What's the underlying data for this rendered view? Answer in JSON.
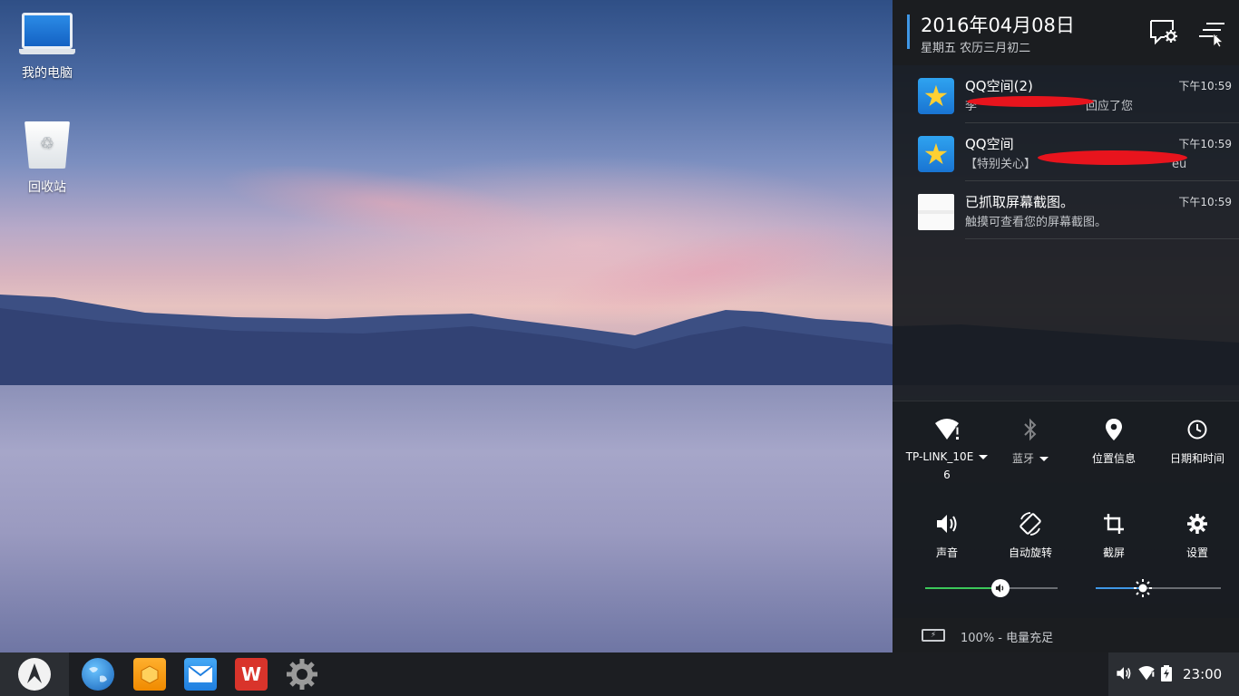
{
  "desktop": {
    "icons": [
      {
        "label": "我的电脑",
        "icon": "computer-icon"
      },
      {
        "label": "回收站",
        "icon": "recycle-bin-icon"
      }
    ]
  },
  "panel": {
    "date": "2016年04月08日",
    "lunar": "星期五 农历三月初二",
    "header_buttons": [
      "notification-settings-icon",
      "clear-all-icon"
    ],
    "notifications": [
      {
        "app": "QQ空间(2)",
        "body_visible_start": "李",
        "body_visible_end": "回应了您",
        "time": "下午10:59",
        "icon": "qzone-star-icon"
      },
      {
        "app": "QQ空间",
        "body_visible_start": "【特别关心】",
        "body_visible_end": "eu",
        "time": "下午10:59",
        "icon": "qzone-star-icon"
      },
      {
        "app": "已抓取屏幕截图。",
        "body": "触摸可查看您的屏幕截图。",
        "time": "下午10:59",
        "icon": "screenshot-thumbnail"
      }
    ],
    "quick_settings": {
      "wifi": {
        "label": "TP-LINK_10E",
        "label_line2": "6",
        "icon": "wifi-alert-icon"
      },
      "bluetooth": {
        "label": "蓝牙",
        "icon": "bluetooth-icon"
      },
      "location": {
        "label": "位置信息",
        "icon": "location-pin-icon"
      },
      "datetime": {
        "label": "日期和时间",
        "icon": "clock-icon"
      },
      "sound": {
        "label": "声音",
        "icon": "speaker-icon"
      },
      "rotate": {
        "label": "自动旋转",
        "icon": "rotate-icon"
      },
      "screenshot": {
        "label": "截屏",
        "icon": "crop-icon"
      },
      "settings": {
        "label": "设置",
        "icon": "gear-icon"
      }
    },
    "sliders": {
      "volume": {
        "fraction": 0.57,
        "color": "#3cc85a",
        "icon": "speaker-icon"
      },
      "brightness": {
        "fraction": 0.38,
        "color": "#3f97e6",
        "icon": "sun-icon"
      }
    },
    "battery_text": "100% - 电量充足"
  },
  "taskbar": {
    "apps": [
      "start-menu-logo",
      "browser-globe-icon",
      "file-manager-icon",
      "mail-icon",
      "wps-office-icon",
      "settings-gear-icon"
    ],
    "wps_label": "W",
    "clock": "23:00",
    "tray_icons": [
      "volume-icon",
      "wifi-icon",
      "battery-icon"
    ]
  },
  "colors": {
    "accent": "#3f97e6",
    "volume_green": "#3cc85a",
    "redaction": "#e8141d"
  }
}
